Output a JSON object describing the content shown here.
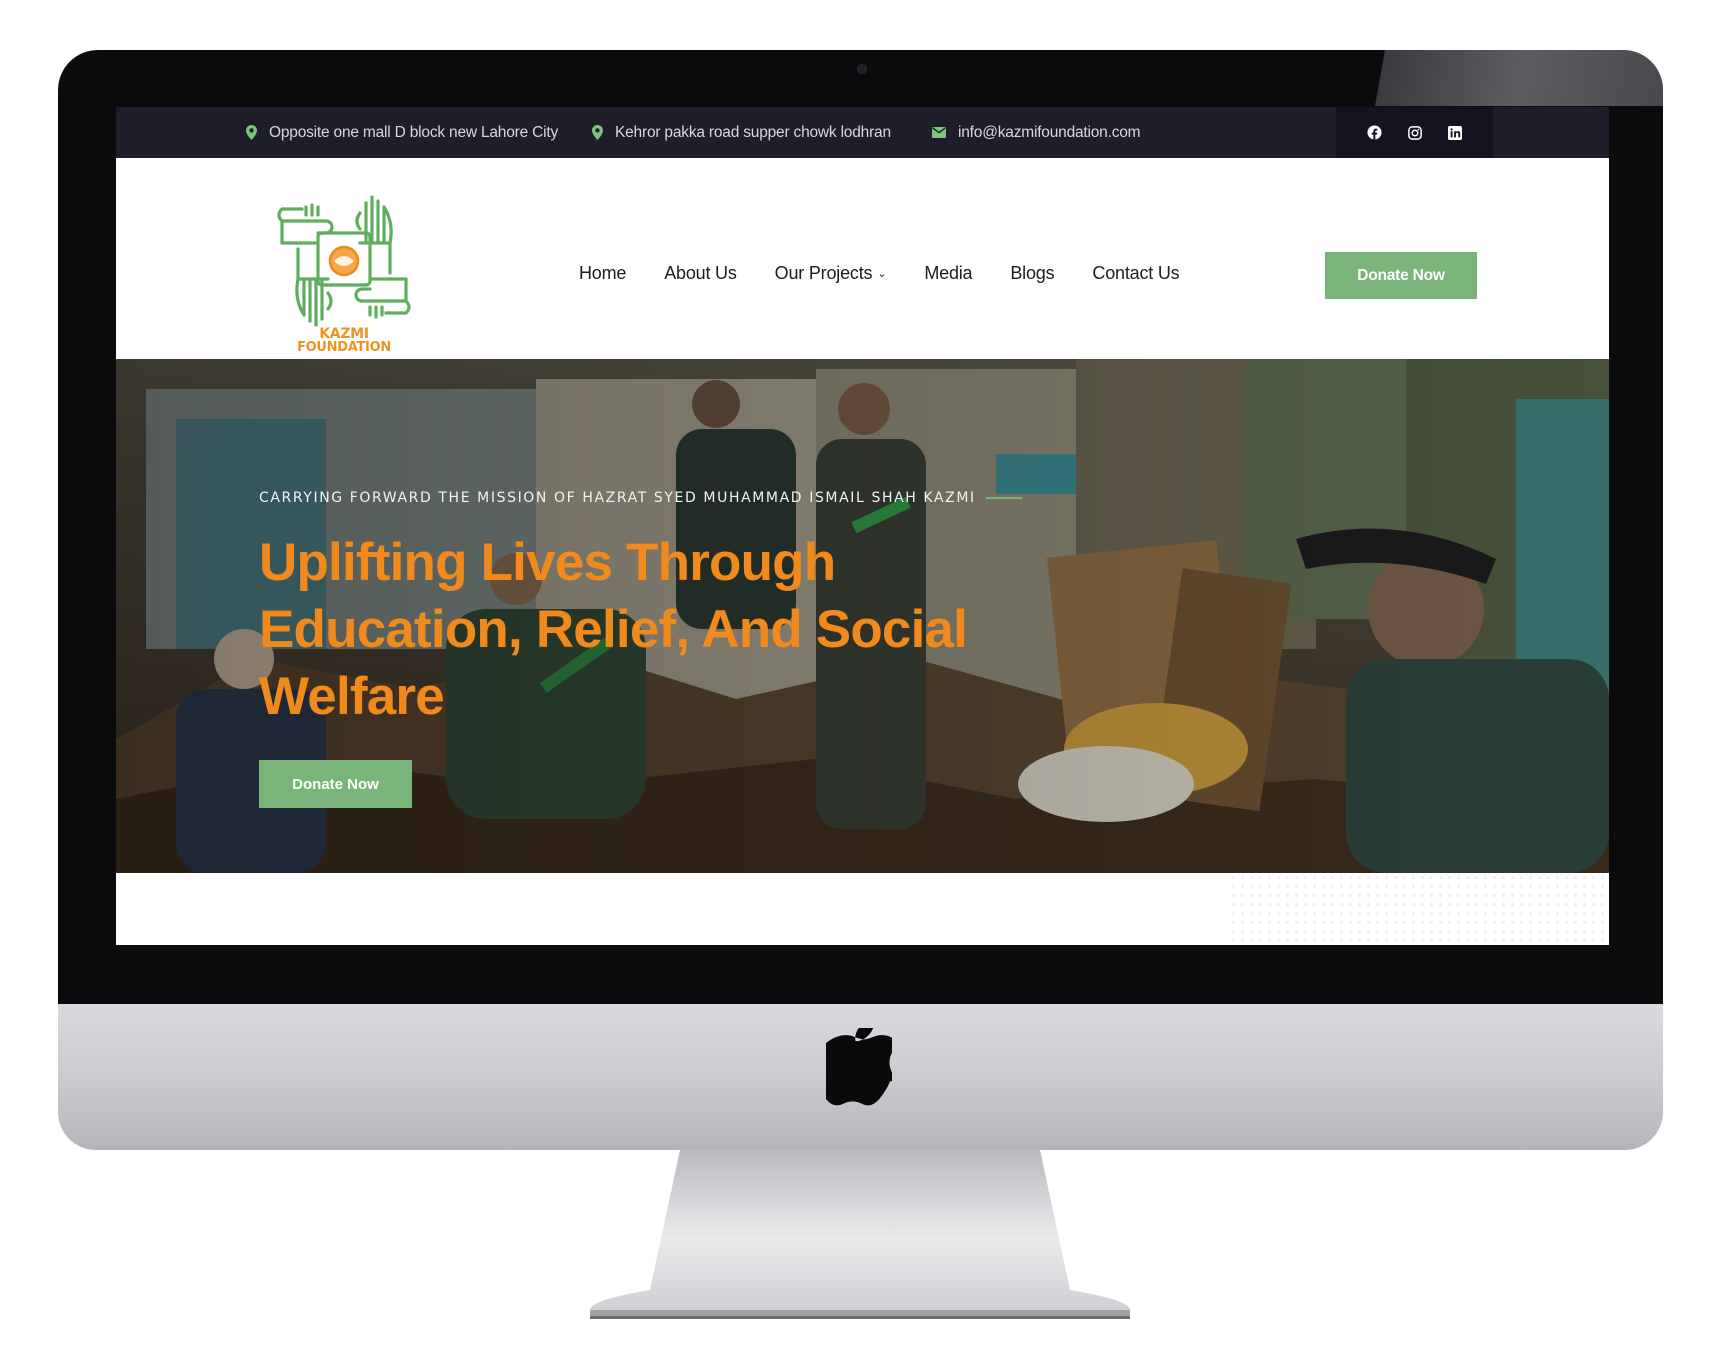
{
  "topbar": {
    "address_1": "Opposite one mall D block new Lahore City",
    "address_2": "Kehror pakka road supper chowk lodhran",
    "email": "info@kazmifoundation.com",
    "social_icons": [
      "facebook-icon",
      "instagram-icon",
      "linkedin-icon"
    ]
  },
  "logo": {
    "line_1": "KAZMI",
    "line_2": "FOUNDATION"
  },
  "nav": {
    "items": [
      {
        "label": "Home"
      },
      {
        "label": "About Us"
      },
      {
        "label": "Our Projects",
        "has_dropdown": true
      },
      {
        "label": "Media"
      },
      {
        "label": "Blogs"
      },
      {
        "label": "Contact Us"
      }
    ],
    "donate_label": "Donate Now"
  },
  "hero": {
    "subtitle": "CARRYING FORWARD THE MISSION OF HAZRAT SYED MUHAMMAD ISMAIL SHAH KAZMI",
    "title_line_1": "Uplifting Lives Through",
    "title_line_2": "Education, Relief, And Social",
    "title_line_3": "Welfare",
    "button_label": "Donate Now"
  },
  "colors": {
    "topbar_bg": "#1d1e29",
    "accent_green": "#7bb47a",
    "accent_orange": "#f08a1d",
    "icon_green": "#7bc67a"
  }
}
